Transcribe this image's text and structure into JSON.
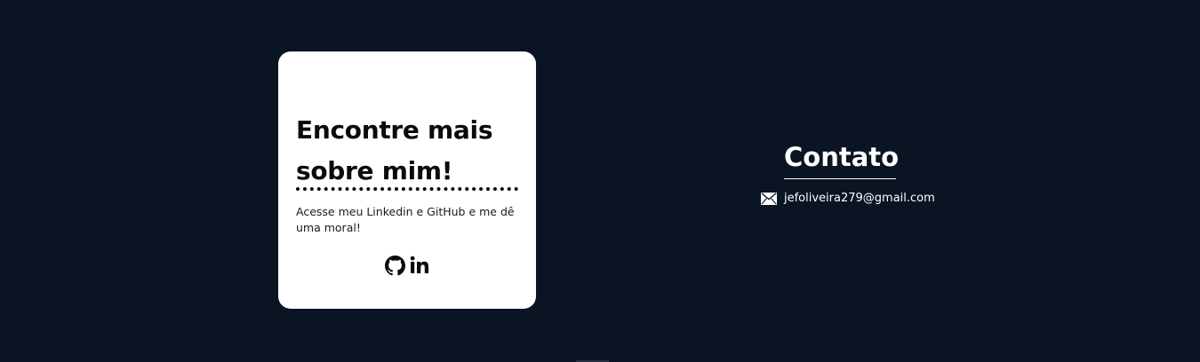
{
  "card": {
    "title": "Encontre mais sobre mim!",
    "text": "Acesse meu Linkedin e GitHub e me dê uma moral!",
    "links": [
      {
        "icon": "github-icon",
        "label": "GitHub"
      },
      {
        "icon": "linkedin-icon",
        "label": "LinkedIn"
      }
    ]
  },
  "contact": {
    "title": "Contato",
    "email": "jefoliveira279@gmail.com",
    "email_icon": "mail-icon"
  },
  "colors": {
    "background": "#0b1423",
    "card": "#ffffff",
    "text_dark": "#0b0b0b",
    "text_light": "#ffffff"
  }
}
